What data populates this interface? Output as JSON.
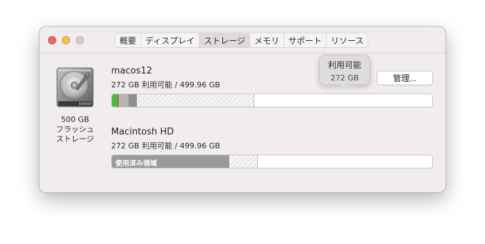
{
  "tabs": [
    {
      "label": "概要",
      "active": false
    },
    {
      "label": "ディスプレイ",
      "active": false
    },
    {
      "label": "ストレージ",
      "active": true
    },
    {
      "label": "メモリ",
      "active": false
    },
    {
      "label": "サポート",
      "active": false
    },
    {
      "label": "リソース",
      "active": false
    }
  ],
  "disk": {
    "icon": "hard-drive-icon",
    "size": "500 GB",
    "type_line1": "フラッシュ",
    "type_line2": "ストレージ"
  },
  "volumes": [
    {
      "name": "macos12",
      "info": "272 GB 利用可能 / 499.96 GB",
      "segments": [
        {
          "category": "apps",
          "color": "#3fc23a",
          "fraction": 0.018
        },
        {
          "category": "other-red",
          "color": "#e0524a",
          "fraction": 0.004
        },
        {
          "category": "system-light",
          "color": "#b5b5b5",
          "fraction": 0.0305
        },
        {
          "category": "system-dark",
          "color": "#8f8f8f",
          "fraction": 0.0265
        },
        {
          "category": "purgeable",
          "color": "#f4f4f4",
          "fraction": 0.367
        }
      ]
    },
    {
      "name": "Macintosh HD",
      "info": "272 GB 利用可能 / 499.96 GB",
      "used_label": "使用済み領域",
      "segments": [
        {
          "category": "used",
          "color": "#9a9a9a",
          "fraction": 0.367
        },
        {
          "category": "purgeable",
          "color": "#f4f4f4",
          "fraction": 0.088
        }
      ]
    }
  ],
  "manage_button": "管理...",
  "tooltip": {
    "title": "利用可能",
    "value": "272 GB"
  },
  "colors": {
    "window_bg": "#f1edef",
    "close": "#ed6a5e",
    "minimize": "#f5bf4f",
    "maximize_disabled": "#d0cdcf",
    "apps_green": "#3fc23a",
    "used_gray": "#9a9a9a"
  }
}
